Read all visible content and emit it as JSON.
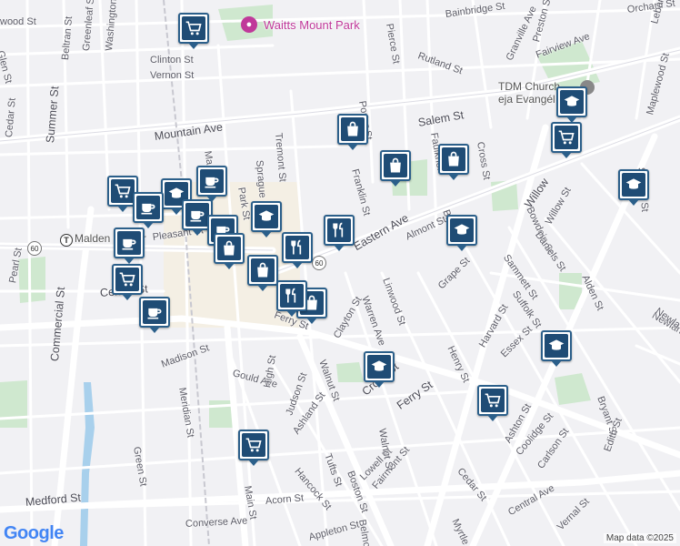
{
  "map": {
    "park_name": "Waitts Mount Park",
    "church_name": "TDM Church",
    "church_name_2": "eja Evangél",
    "transit_station": "Malden Center",
    "route_shield": "60",
    "attribution": "Map data ©2025",
    "logo_text": "Google",
    "street_labels": [
      "Bainbridge St",
      "Orchard St",
      "Lebanon",
      "Preston St",
      "Granville Ave",
      "Fairview Ave",
      "Maplewood St",
      "Rutland St",
      "Glen St",
      "Greenleaf St",
      "Washington St",
      "Clinton St",
      "Vernon St",
      "Beltran St",
      "wood St",
      "Summer St",
      "Cedar St",
      "Mountain Ave",
      "Salem St",
      "Cross St",
      "Tremont St",
      "Sprague St",
      "Park St",
      "Franklin St",
      "Faulkner",
      "Eastern Ave",
      "Almont St",
      "Bowdoin St",
      "Daniels St",
      "Sharon St",
      "Pleasant St",
      "Centre St",
      "Commercial St",
      "Pearl St",
      "Linwood St",
      "Warren Ave",
      "Clayton St",
      "Grape St",
      "Sammett St",
      "Suffolk St",
      "Alden St",
      "Newland St",
      "Henry St",
      "Harvard St",
      "Essex St",
      "Madison St",
      "Gould Ave",
      "Walnut St",
      "Meridian St",
      "Judson St",
      "High St",
      "Ashland St",
      "Cross St",
      "Ferry St",
      "Bryant St",
      "Edith St",
      "Ashton St",
      "Coolidge St",
      "Carlson St",
      "Green St",
      "Tufts St",
      "Boston St",
      "Lowell St",
      "Fairmont St",
      "Cedar St",
      "Medford St",
      "Main St",
      "Hancock St",
      "Acorn St",
      "Converse Ave",
      "Belmont St",
      "Myrtle St",
      "Central Ave",
      "Vernal St",
      "Appleton St",
      "Porter St",
      "Ferry St",
      "Walnut St",
      "Willow",
      "Pierce St",
      "Willow St",
      "Ma",
      "Bro",
      "Newla"
    ],
    "pins": [
      {
        "icon": "cart"
      },
      {
        "icon": "cart"
      },
      {
        "icon": "cart"
      },
      {
        "icon": "cart"
      },
      {
        "icon": "cart"
      },
      {
        "icon": "cart"
      },
      {
        "icon": "school"
      },
      {
        "icon": "school"
      },
      {
        "icon": "school"
      },
      {
        "icon": "school"
      },
      {
        "icon": "school"
      },
      {
        "icon": "school"
      },
      {
        "icon": "school"
      },
      {
        "icon": "coffee"
      },
      {
        "icon": "coffee"
      },
      {
        "icon": "coffee"
      },
      {
        "icon": "coffee"
      },
      {
        "icon": "coffee"
      },
      {
        "icon": "coffee"
      },
      {
        "icon": "bag"
      },
      {
        "icon": "bag"
      },
      {
        "icon": "bag"
      },
      {
        "icon": "bag"
      },
      {
        "icon": "bag"
      },
      {
        "icon": "bag"
      },
      {
        "icon": "fork"
      },
      {
        "icon": "fork"
      },
      {
        "icon": "fork"
      }
    ]
  }
}
